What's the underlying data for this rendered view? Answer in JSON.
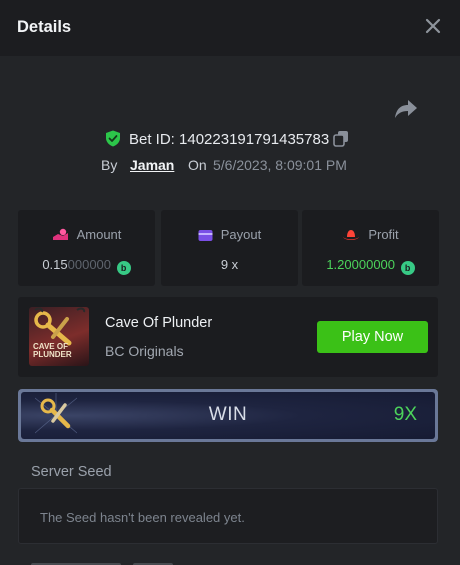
{
  "header": {
    "title": "Details",
    "close_icon": "close-icon"
  },
  "bet": {
    "share_icon": "share-icon",
    "verified_icon": "shield-check-icon",
    "id_text": "Bet ID: 140223191791435783",
    "copy_icon": "copy-icon",
    "by_label": "By",
    "user": "Jaman",
    "on_label": "On",
    "date": "5/6/2023, 8:09:01 PM"
  },
  "stats": [
    {
      "label": "Amount",
      "icon": "money-bag-icon",
      "value_main": "0.15",
      "value_dim": "000000",
      "coin": "b",
      "main_color": "#c9ced5"
    },
    {
      "label": "Payout",
      "icon": "wallet-icon",
      "value_main": "9 x",
      "value_dim": "",
      "coin": "",
      "main_color": "#c9ced5"
    },
    {
      "label": "Profit",
      "icon": "cowboy-hat-icon",
      "value_main": "1.2",
      "value_dim": "0000000",
      "coin": "b",
      "main_color": "#4cd35b"
    }
  ],
  "game": {
    "thumb_text": "CAVE OF PLUNDER",
    "name": "Cave Of Plunder",
    "provider": "BC Originals",
    "play_label": "Play Now"
  },
  "result": {
    "label": "WIN",
    "multiplier": "9X",
    "symbol_icon": "treasure-key-icon"
  },
  "seed": {
    "label": "Server Seed",
    "message": "The Seed hasn't been revealed yet."
  },
  "colors": {
    "accent_green": "#3bc117",
    "win_green": "#4cd35b",
    "background": "#232528"
  }
}
